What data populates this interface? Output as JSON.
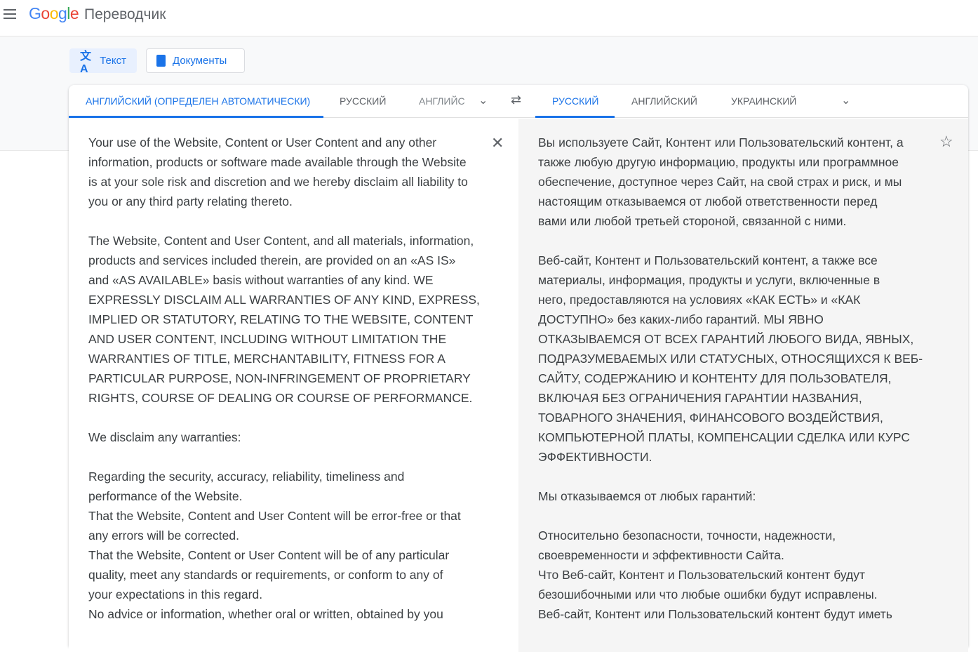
{
  "header": {
    "logo": "Google",
    "product": "Переводчик"
  },
  "modes": {
    "text": "Текст",
    "documents": "Документы"
  },
  "source_tabs": [
    "АНГЛИЙСКИЙ (ОПРЕДЕЛЕН АВТОМАТИЧЕСКИ)",
    "РУССКИЙ",
    "АНГЛИЙС"
  ],
  "target_tabs": [
    "РУССКИЙ",
    "АНГЛИЙСКИЙ",
    "УКРАИНСКИЙ"
  ],
  "source_text": "Your use of the Website, Content or User Content and any other\ninformation, products or software made available through the Website\nis at your sole risk and discretion and we hereby disclaim all liability to\nyou or any third party relating thereto.\n\nThe Website, Content and User Content, and all materials, information,\nproducts and services included therein, are provided on an «AS IS»\nand «AS AVAILABLE» basis without warranties of any kind. WE\nEXPRESSLY DISCLAIM ALL WARRANTIES OF ANY KIND, EXPRESS,\nIMPLIED OR STATUTORY, RELATING TO THE WEBSITE, CONTENT\nAND USER CONTENT, INCLUDING WITHOUT LIMITATION THE\nWARRANTIES OF TITLE, MERCHANTABILITY, FITNESS FOR A\nPARTICULAR PURPOSE, NON-INFRINGEMENT OF PROPRIETARY\nRIGHTS, COURSE OF DEALING OR COURSE OF PERFORMANCE.\n\nWe disclaim any warranties:\n\nRegarding the security, accuracy, reliability, timeliness and\nperformance of the Website.\nThat the Website, Content and User Content will be error-free or that\nany errors will be corrected.\nThat the Website, Content or User Content will be of any particular\nquality, meet any standards or requirements, or conform to any of\nyour expectations in this regard.\nNo advice or information, whether oral or written, obtained by you",
  "translated_text": "Вы используете Сайт, Контент или Пользовательский контент, а\nтакже любую другую информацию, продукты или программное\nобеспечение, доступное через Сайт, на свой страх и риск, и мы\nнастоящим отказываемся от любой ответственности перед\nвами или любой третьей стороной, связанной с ними.\n\nВеб-сайт, Контент и Пользовательский контент, а также все\nматериалы, информация, продукты и услуги, включенные в\nнего, предоставляются на условиях «КАК ЕСТЬ» и «КАК\nДОСТУПНО» без каких-либо гарантий. МЫ ЯВНО\nОТКАЗЫВАЕМСЯ ОТ ВСЕХ ГАРАНТИЙ ЛЮБОГО ВИДА, ЯВНЫХ,\nПОДРАЗУМЕВАЕМЫХ ИЛИ СТАТУСНЫХ, ОТНОСЯЩИХСЯ К ВЕБ-\nСАЙТУ, СОДЕРЖАНИЮ И КОНТЕНТУ ДЛЯ ПОЛЬЗОВАТЕЛЯ,\nВКЛЮЧАЯ БЕЗ ОГРАНИЧЕНИЯ ГАРАНТИИ НАЗВАНИЯ,\nТОВАРНОГО ЗНАЧЕНИЯ, ФИНАНСОВОГО ВОЗДЕЙСТВИЯ,\nКОМПЬЮТЕРНОЙ ПЛАТЫ, КОМПЕНСАЦИИ СДЕЛКА ИЛИ КУРС\nЭФФЕКТИВНОСТИ.\n\nМы отказываемся от любых гарантий:\n\nОтносительно безопасности, точности, надежности,\nсвоевременности и эффективности Сайта.\nЧто Веб-сайт, Контент и Пользовательский контент будут\nбезошибочными или что любые ошибки будут исправлены.\nВеб-сайт, Контент или Пользовательский контент будут иметь"
}
